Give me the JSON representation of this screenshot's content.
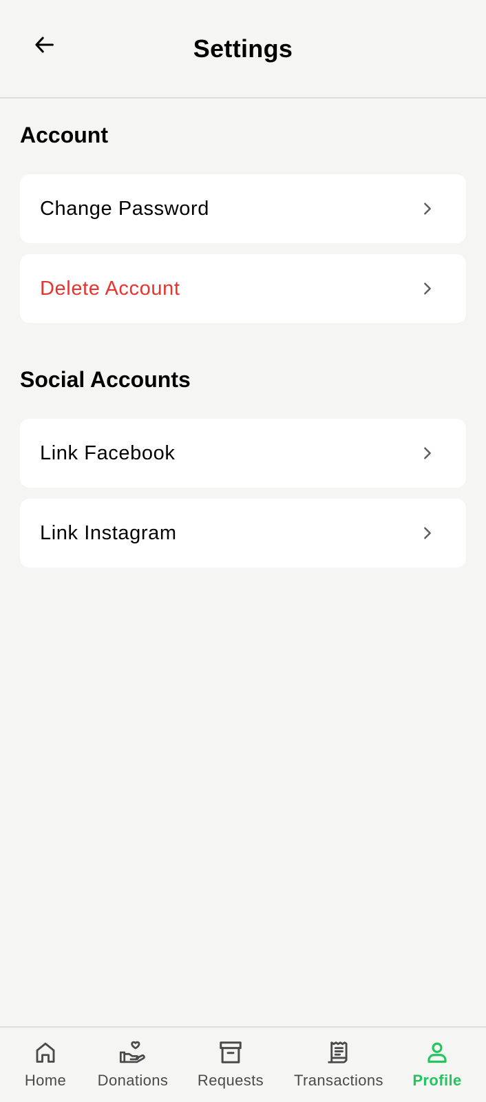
{
  "header": {
    "title": "Settings"
  },
  "sections": [
    {
      "title": "Account",
      "items": [
        {
          "label": "Change Password"
        },
        {
          "label": "Delete Account"
        }
      ]
    },
    {
      "title": "Social Accounts",
      "items": [
        {
          "label": "Link Facebook"
        },
        {
          "label": "Link Instagram"
        }
      ]
    }
  ],
  "tabbar": {
    "tabs": [
      {
        "label": "Home",
        "icon": "home-icon"
      },
      {
        "label": "Donations",
        "icon": "hand-heart-icon"
      },
      {
        "label": "Requests",
        "icon": "archive-box-icon"
      },
      {
        "label": "Transactions",
        "icon": "receipt-icon"
      },
      {
        "label": "Profile",
        "icon": "user-icon",
        "active": true
      }
    ]
  },
  "colors": {
    "background": "#f5f6f4",
    "danger": "#e8332e",
    "active": "#22c55e",
    "inactive": "#4a4a4a"
  }
}
